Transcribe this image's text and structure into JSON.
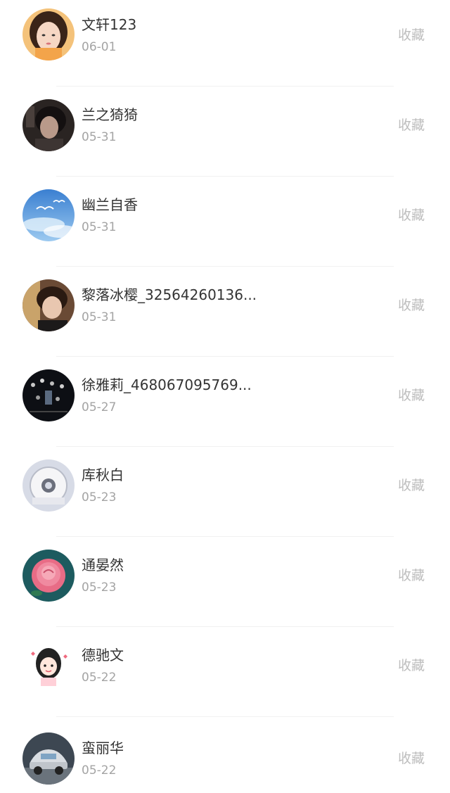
{
  "favorite_label": "收藏",
  "items": [
    {
      "name": "文轩123",
      "date": "06-01",
      "avatar": "girl-portrait-avatar"
    },
    {
      "name": "兰之猗猗",
      "date": "05-31",
      "avatar": "dark-portrait-avatar"
    },
    {
      "name": "幽兰自香",
      "date": "05-31",
      "avatar": "sky-birds-avatar"
    },
    {
      "name": "黎落冰樱_32564260136...",
      "date": "05-31",
      "avatar": "boy-portrait-avatar"
    },
    {
      "name": "徐雅莉_468067095769...",
      "date": "05-27",
      "avatar": "night-crowd-avatar"
    },
    {
      "name": "库秋白",
      "date": "05-23",
      "avatar": "round-badge-avatar"
    },
    {
      "name": "通晏然",
      "date": "05-23",
      "avatar": "pink-rose-avatar"
    },
    {
      "name": "德驰文",
      "date": "05-22",
      "avatar": "cartoon-girl-avatar"
    },
    {
      "name": "蛮丽华",
      "date": "05-22",
      "avatar": "car-avatar"
    }
  ]
}
